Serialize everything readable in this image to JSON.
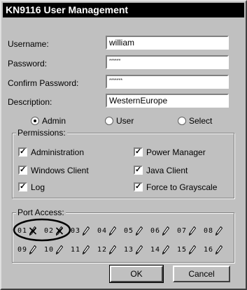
{
  "window": {
    "title": "KN9116 User Management"
  },
  "form": {
    "username_label": "Username:",
    "username_value": "william",
    "password_label": "Password:",
    "password_value": "******",
    "confirm_label": "Confirm Password:",
    "confirm_value": "*******",
    "description_label": "Description:",
    "description_value": "WesternEurope"
  },
  "role": {
    "options": [
      "Admin",
      "User",
      "Select"
    ],
    "selected": "Admin"
  },
  "permissions": {
    "legend": "Permissions:",
    "items": [
      {
        "label": "Administration",
        "checked": true
      },
      {
        "label": "Power Manager",
        "checked": true
      },
      {
        "label": "Windows Client",
        "checked": true
      },
      {
        "label": "Java Client",
        "checked": true
      },
      {
        "label": "Log",
        "checked": true
      },
      {
        "label": "Force to Grayscale",
        "checked": true
      }
    ]
  },
  "port_access": {
    "legend": "Port Access:",
    "ports": [
      {
        "num": "01",
        "state": "denied"
      },
      {
        "num": "02",
        "state": "denied"
      },
      {
        "num": "03",
        "state": "allowed"
      },
      {
        "num": "04",
        "state": "allowed"
      },
      {
        "num": "05",
        "state": "allowed"
      },
      {
        "num": "06",
        "state": "allowed"
      },
      {
        "num": "07",
        "state": "allowed"
      },
      {
        "num": "08",
        "state": "allowed"
      },
      {
        "num": "09",
        "state": "allowed"
      },
      {
        "num": "10",
        "state": "allowed"
      },
      {
        "num": "11",
        "state": "allowed"
      },
      {
        "num": "12",
        "state": "allowed"
      },
      {
        "num": "13",
        "state": "allowed"
      },
      {
        "num": "14",
        "state": "allowed"
      },
      {
        "num": "15",
        "state": "allowed"
      },
      {
        "num": "16",
        "state": "allowed"
      }
    ]
  },
  "buttons": {
    "ok": "OK",
    "cancel": "Cancel"
  }
}
